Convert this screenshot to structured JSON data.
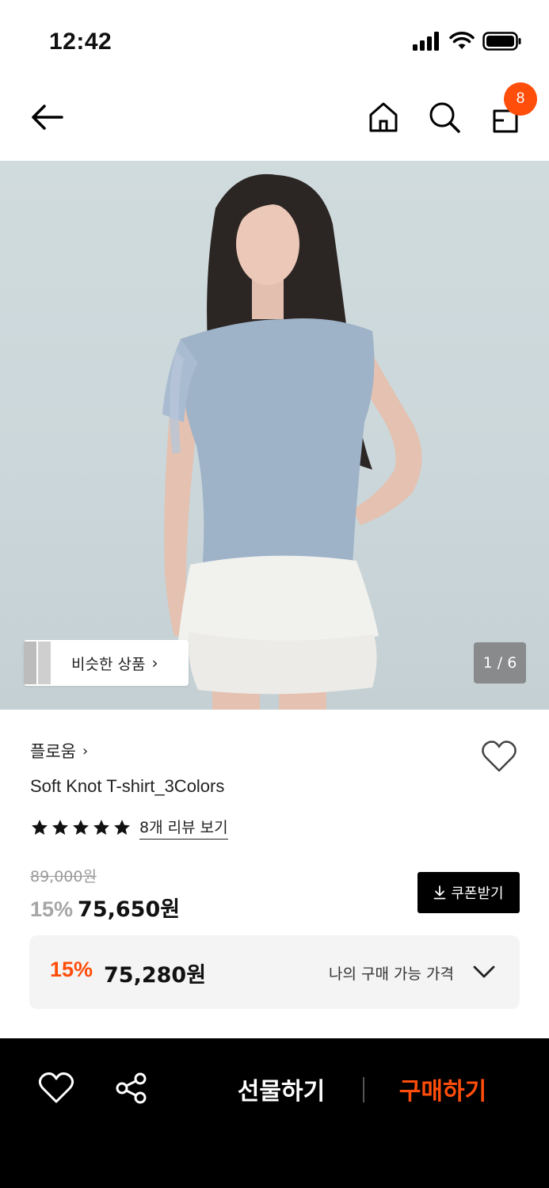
{
  "status_bar": {
    "time": "12:42",
    "icons": [
      "cellular-signal-icon",
      "wifi-icon",
      "battery-icon"
    ]
  },
  "nav": {
    "back_icon": "back-arrow-icon",
    "home_icon": "home-icon",
    "search_icon": "search-icon",
    "bag_icon": "shopping-bag-icon",
    "bag_count": "8",
    "badge_color": "#ff4d0a"
  },
  "hero": {
    "similar_label": "비슷한 상품",
    "pager": "1 / 6",
    "description": "Model wearing light blue off-shoulder knot t-shirt with white eyelet ruffle skirt"
  },
  "product": {
    "brand": "플로움",
    "title": "Soft Knot T-shirt_3Colors",
    "rating_stars": 5,
    "review_link": "8개 리뷰 보기",
    "original_price": "89,000원",
    "discount_pct": "15%",
    "sale_price": "75,650원",
    "coupon_label": "쿠폰받기"
  },
  "my_price": {
    "discount_pct": "15%",
    "price": "75,280원",
    "label": "나의 구매 가능 가격"
  },
  "bottom_bar": {
    "gift_label": "선물하기",
    "buy_label": "구매하기",
    "accent_color": "#ff4d0a"
  }
}
